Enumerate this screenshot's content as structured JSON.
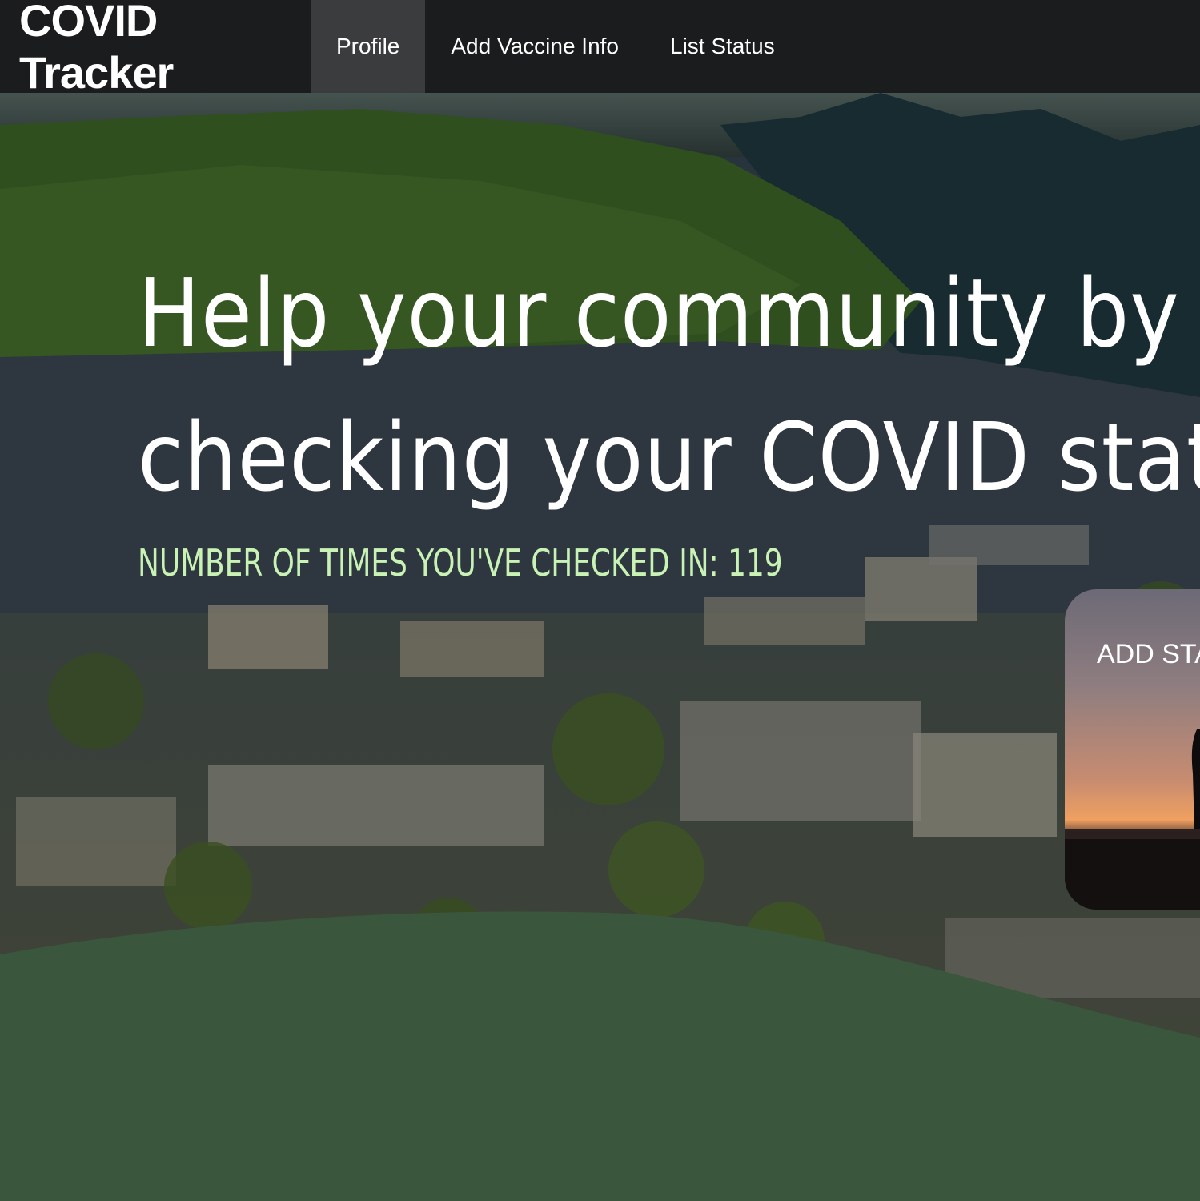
{
  "navbar": {
    "brand": "COVID Tracker",
    "items": [
      {
        "label": "Profile",
        "active": true
      },
      {
        "label": "Add Vaccine Info",
        "active": false
      },
      {
        "label": "List Status",
        "active": false
      }
    ]
  },
  "hero": {
    "title_line1": "Help your community by",
    "title_line2": "checking your COVID status",
    "checkin_text": "NUMBER OF TIMES YOU'VE CHECKED IN: 119",
    "status_card_label": "ADD STATUS"
  },
  "colors": {
    "navbar_bg": "#1b1c1d",
    "active_nav_bg": "#3b3c3e",
    "checkin_text": "#c9f2b5",
    "wave_green": "#3a563c"
  }
}
